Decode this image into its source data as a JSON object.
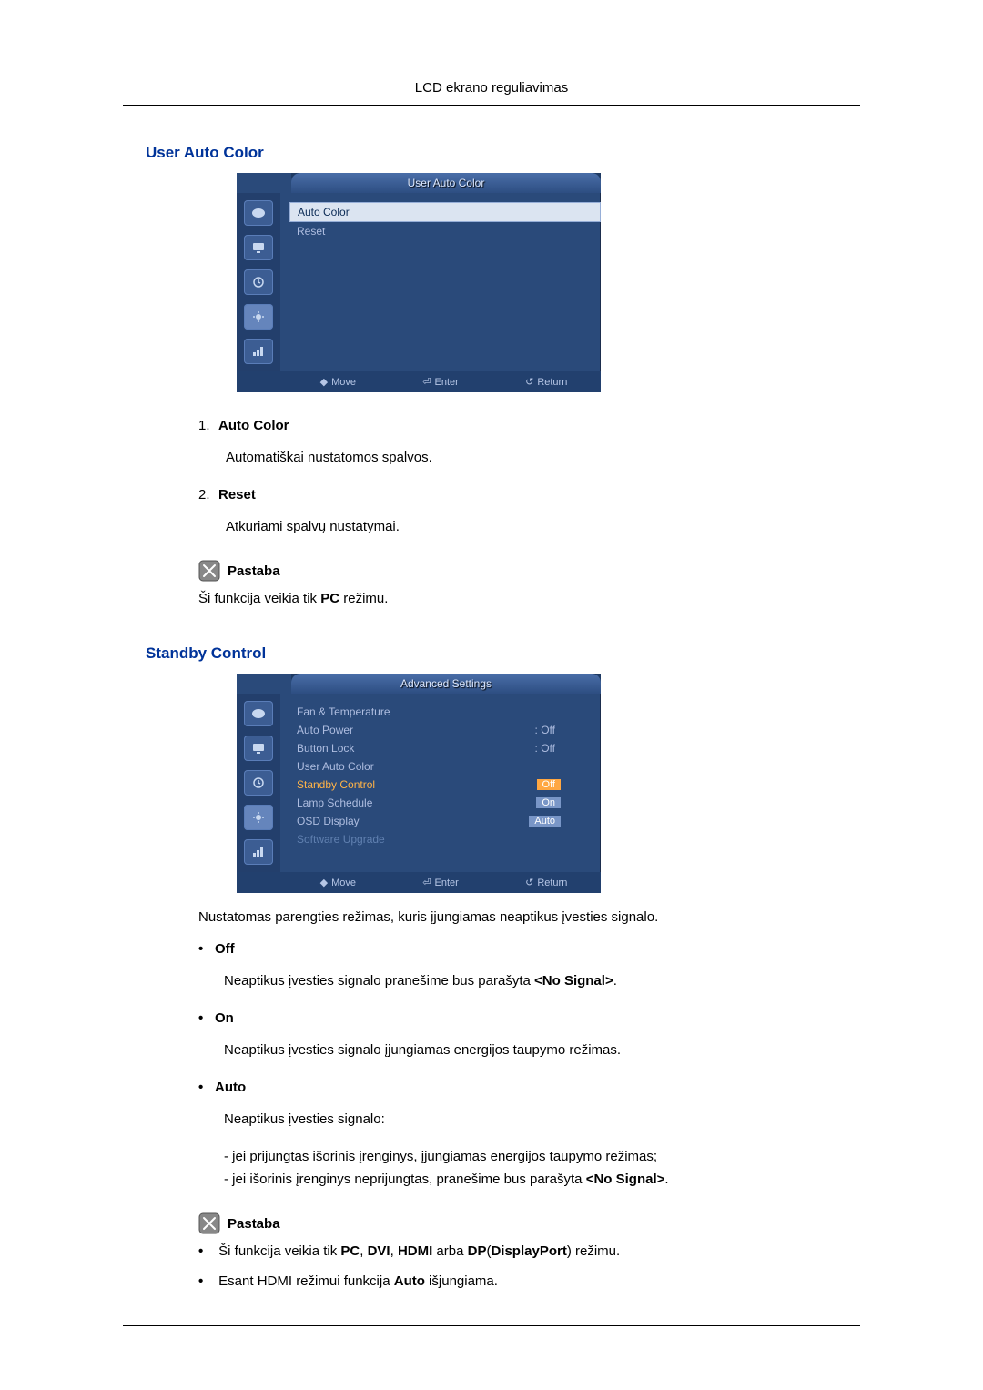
{
  "header": {
    "title": "LCD ekrano reguliavimas"
  },
  "section1": {
    "title": "User Auto Color",
    "osd": {
      "title": "User Auto Color",
      "items": [
        {
          "label": "Auto Color",
          "selected": true
        },
        {
          "label": "Reset"
        }
      ],
      "footer": {
        "move": "Move",
        "enter": "Enter",
        "return": "Return"
      }
    },
    "numbered": [
      {
        "num": "1.",
        "label": "Auto Color",
        "desc": "Automatiškai nustatomos spalvos."
      },
      {
        "num": "2.",
        "label": "Reset",
        "desc": "Atkuriami spalvų nustatymai."
      }
    ],
    "note": {
      "label": "Pastaba",
      "text_pre": "Ši funkcija veikia tik ",
      "text_bold": "PC",
      "text_post": " režimu."
    }
  },
  "section2": {
    "title": "Standby Control",
    "osd": {
      "title": "Advanced Settings",
      "items": [
        {
          "label": "Fan & Temperature"
        },
        {
          "label": "Auto Power",
          "val": ": Off"
        },
        {
          "label": "Button Lock",
          "val": ": Off"
        },
        {
          "label": "User Auto Color"
        },
        {
          "label": "Standby Control",
          "hilite": true,
          "tag": "Off",
          "tag_sel": true
        },
        {
          "label": "Lamp Schedule",
          "tag": "On"
        },
        {
          "label": "OSD Display",
          "tag": "Auto"
        },
        {
          "label": "Software Upgrade",
          "faded": true
        }
      ],
      "footer": {
        "move": "Move",
        "enter": "Enter",
        "return": "Return"
      }
    },
    "intro": "Nustatomas parengties režimas, kuris įjungiamas neaptikus įvesties signalo.",
    "bullets": [
      {
        "label": "Off",
        "desc_pre": "Neaptikus įvesties signalo pranešime bus parašyta ",
        "desc_bold": "<No Signal>",
        "desc_post": "."
      },
      {
        "label": "On",
        "desc": "Neaptikus įvesties signalo įjungiamas energijos taupymo režimas."
      },
      {
        "label": "Auto",
        "desc": "Neaptikus įvesties signalo:",
        "sub": [
          {
            "text": "- jei prijungtas išorinis įrenginys, įjungiamas energijos taupymo režimas;"
          },
          {
            "pre": "- jei išorinis įrenginys neprijungtas, pranešime bus parašyta ",
            "bold": "<No Signal>",
            "post": "."
          }
        ]
      }
    ],
    "note": {
      "label": "Pastaba",
      "items": [
        {
          "pre": "Ši funkcija veikia tik ",
          "b1": "PC",
          "c1": ", ",
          "b2": "DVI",
          "c2": ", ",
          "b3": "HDMI",
          "c3": " arba ",
          "b4": "DP",
          "paren_pre": "(",
          "b5": "DisplayPort",
          "paren_post": ")",
          "post": " režimu."
        },
        {
          "pre": "Esant HDMI režimui funkcija ",
          "b1": "Auto",
          "post": " išjungiama."
        }
      ]
    }
  }
}
